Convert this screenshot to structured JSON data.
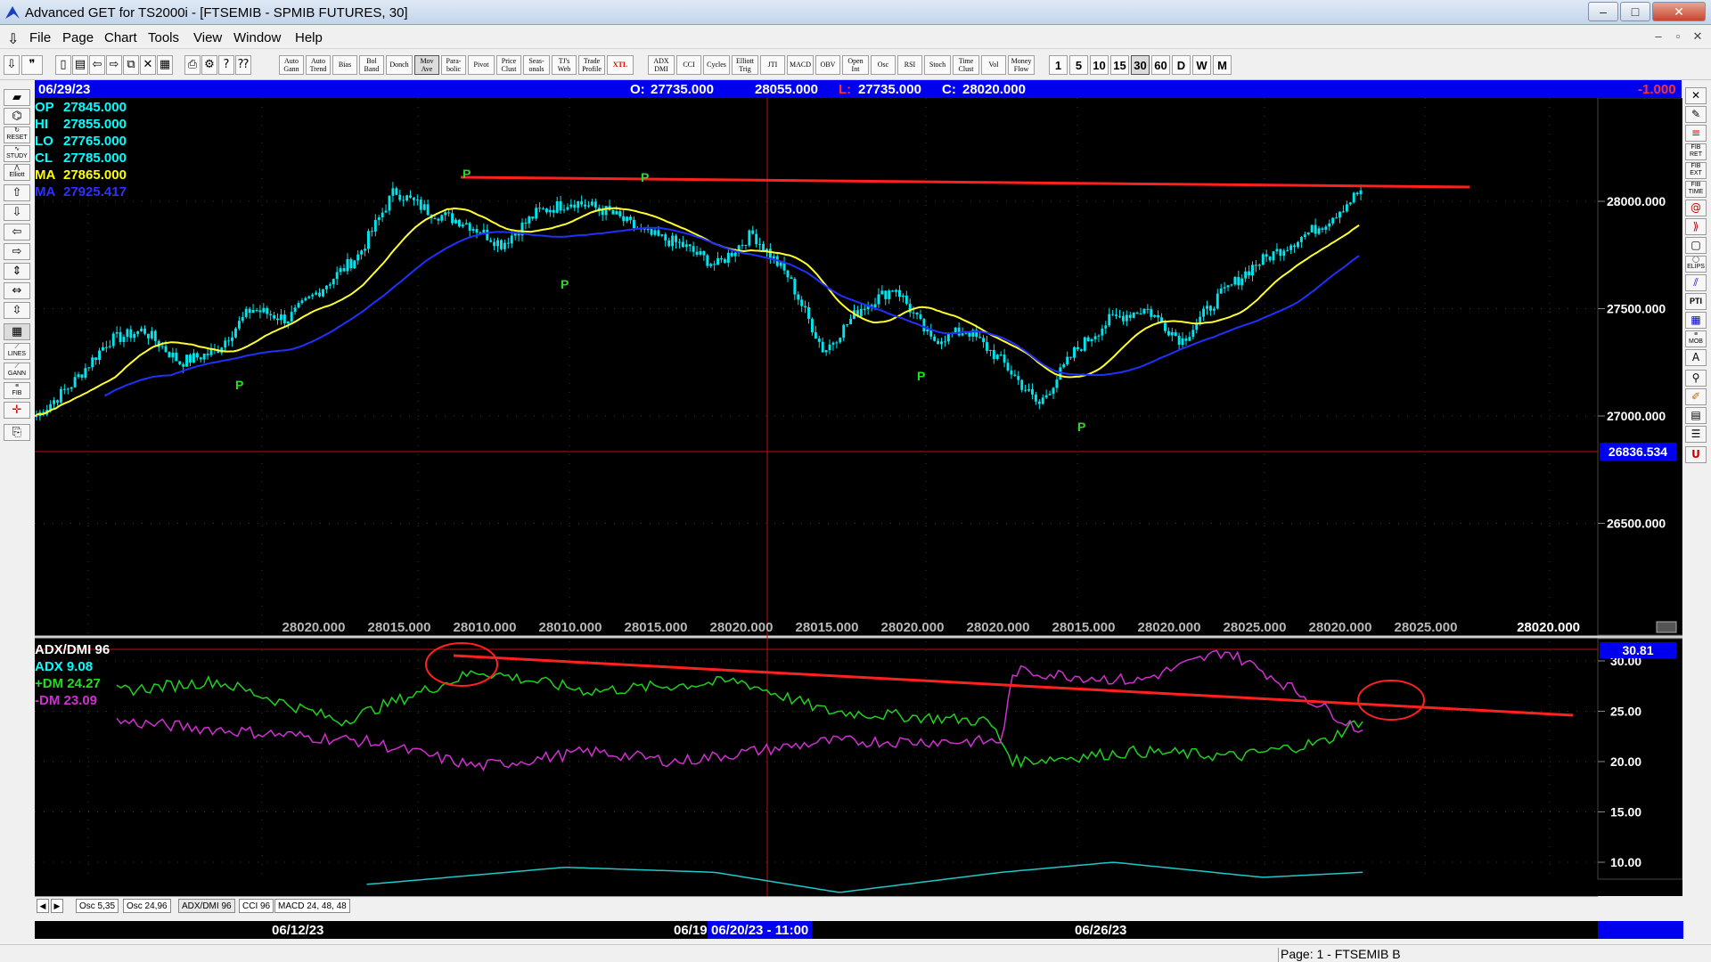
{
  "window": {
    "title": "Advanced GET for TS2000i - [FTSEMIB - SPMIB FUTURES, 30]",
    "controls": [
      "–",
      "□",
      "✕"
    ]
  },
  "menu": {
    "items": [
      "File",
      "Page",
      "Chart",
      "Tools",
      "View",
      "Window",
      "Help"
    ],
    "mdi_controls": [
      "–",
      "▫",
      "✕"
    ]
  },
  "toolbar": {
    "studies": [
      "Auto Gann",
      "Auto Trend",
      "Bias",
      "Bol Band",
      "Donch",
      "Mov Ave",
      "Para-bolic",
      "Pivot",
      "Price Clust",
      "Seas-onals",
      "TJ's Web",
      "Trade Profile",
      "XTL"
    ],
    "osc": [
      "ADX DMI",
      "CCI",
      "Cycles",
      "Elliott Trig",
      "JTI",
      "MACD",
      "OBV",
      "Open Int",
      "Osc",
      "RSI",
      "Stoch",
      "Time Clust",
      "Vol",
      "Money Flow"
    ],
    "periods": [
      "1",
      "5",
      "10",
      "15",
      "30",
      "60",
      "D",
      "W",
      "M"
    ],
    "active_period": "30"
  },
  "info_bar": {
    "date": "06/29/23",
    "open_label": "O:",
    "open": "27735.000",
    "high": "28055.000",
    "low_label": "L:",
    "low": "27735.000",
    "close_label": "C:",
    "close": "28020.000",
    "change": "-1.000"
  },
  "legend": [
    {
      "label": "OP",
      "value": "27845.000",
      "color": "#00ffff"
    },
    {
      "label": "HI",
      "value": "27855.000",
      "color": "#00ffff"
    },
    {
      "label": "LO",
      "value": "27765.000",
      "color": "#00ffff"
    },
    {
      "label": "CL",
      "value": "27785.000",
      "color": "#00ffff"
    },
    {
      "label": "MA",
      "value": "27865.000",
      "color": "#ffff00"
    },
    {
      "label": "MA",
      "value": "27925.417",
      "color": "#3030ff"
    }
  ],
  "price_axis": {
    "ticks": [
      "28000.000",
      "27500.000",
      "27000.000",
      "26500.000"
    ],
    "cursor_price": "26836.534"
  },
  "bottom_values": [
    "28020.000",
    "28015.000",
    "28010.000",
    "28010.000",
    "28015.000",
    "28020.000",
    "28015.000",
    "28020.000",
    "28020.000",
    "28015.000",
    "28020.000",
    "28025.000",
    "28020.000",
    "28025.000"
  ],
  "bottom_value_current": "28020.000",
  "pivot_label": "P",
  "indicator": {
    "title": "ADX/DMI 96",
    "adx": "ADX 9.08",
    "plus_dm": "+DM 24.27",
    "minus_dm": "-DM 23.09",
    "current_value": "30.81",
    "ticks": [
      "30.00",
      "25.00",
      "20.00",
      "15.00",
      "10.00"
    ]
  },
  "tabs": [
    "Osc 5,35",
    "Osc 24,96",
    "ADX/DMI 96",
    "CCI 96",
    "MACD 24, 48, 48"
  ],
  "active_tab": "ADX/DMI 96",
  "dates": {
    "labels": [
      "06/12/23",
      "06/19",
      "06/26/23"
    ],
    "selected": "06/20/23 - 11:00"
  },
  "status": {
    "page": "Page: 1 - FTSEMIB B"
  },
  "colors": {
    "price_bars": "#00e5ee",
    "ma_fast": "#ffff30",
    "ma_slow": "#2030ff",
    "trendline": "#ff2020",
    "plus_dm": "#20d020",
    "minus_dm": "#d030d0",
    "adx": "#20c8c8",
    "pivot": "#20e020"
  },
  "chart_data": {
    "type": "line",
    "price_ticks": [
      28000,
      27500,
      27000,
      26500
    ],
    "indicator_ticks": [
      30,
      25,
      20,
      15,
      10
    ],
    "price_series": [
      27000,
      27150,
      27350,
      27400,
      27250,
      27300,
      27500,
      27450,
      27600,
      27750,
      28050,
      27950,
      27900,
      27800,
      27950,
      28000,
      27950,
      27850,
      27800,
      27700,
      27850,
      27650,
      27300,
      27500,
      27600,
      27350,
      27400,
      27250,
      27050,
      27300,
      27450,
      27500,
      27350,
      27550,
      27700,
      27800,
      27900,
      28050
    ]
  }
}
